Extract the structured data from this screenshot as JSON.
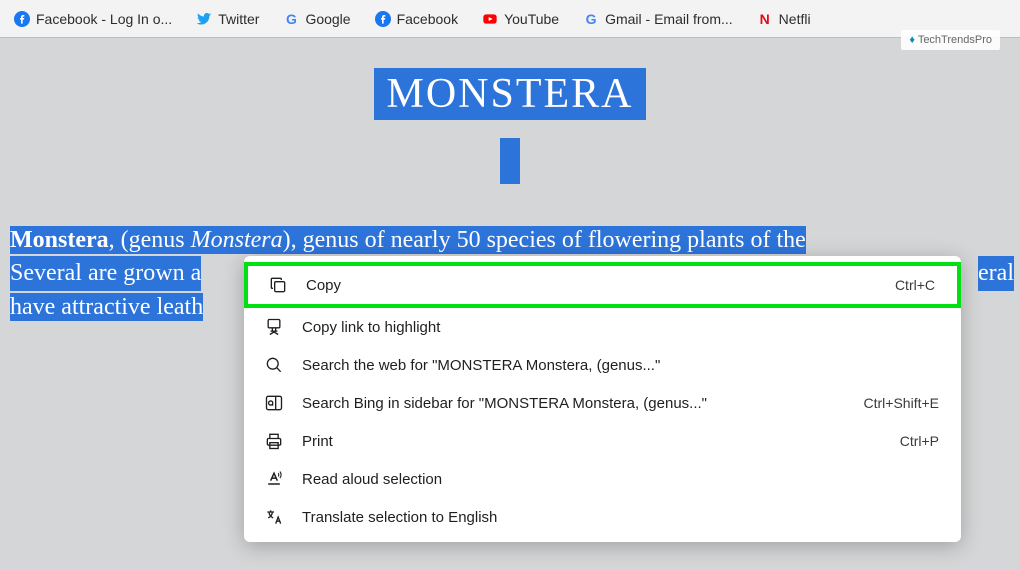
{
  "bookmarks": [
    {
      "label": "Facebook - Log In o...",
      "icon": "facebook"
    },
    {
      "label": "Twitter",
      "icon": "twitter"
    },
    {
      "label": "Google",
      "icon": "google"
    },
    {
      "label": "Facebook",
      "icon": "facebook"
    },
    {
      "label": "YouTube",
      "icon": "youtube"
    },
    {
      "label": "Gmail - Email from...",
      "icon": "google"
    },
    {
      "label": "Netfli",
      "icon": "netflix"
    }
  ],
  "watermark": "TechTrendsPro",
  "page": {
    "title": "MONSTERA",
    "line1_bold": "Monstera",
    "line1_rest_a": ", (genus ",
    "line1_italic": "Monstera",
    "line1_rest_b": "), genus of nearly 50 species of flowering plants of the",
    "line2": "Several are grown a",
    "line2_end": "eral",
    "line3": "have attractive leath"
  },
  "context_menu": {
    "items": [
      {
        "label": "Copy",
        "shortcut": "Ctrl+C",
        "icon": "copy",
        "highlighted": true
      },
      {
        "label": "Copy link to highlight",
        "shortcut": "",
        "icon": "link-highlight"
      },
      {
        "label": "Search the web for \"MONSTERA     Monstera, (genus...\"",
        "shortcut": "",
        "icon": "search"
      },
      {
        "label": "Search Bing in sidebar for \"MONSTERA     Monstera, (genus...\"",
        "shortcut": "Ctrl+Shift+E",
        "icon": "sidebar-search"
      },
      {
        "label": "Print",
        "shortcut": "Ctrl+P",
        "icon": "print"
      },
      {
        "label": "Read aloud selection",
        "shortcut": "",
        "icon": "read-aloud"
      },
      {
        "label": "Translate selection to English",
        "shortcut": "",
        "icon": "translate"
      }
    ]
  }
}
